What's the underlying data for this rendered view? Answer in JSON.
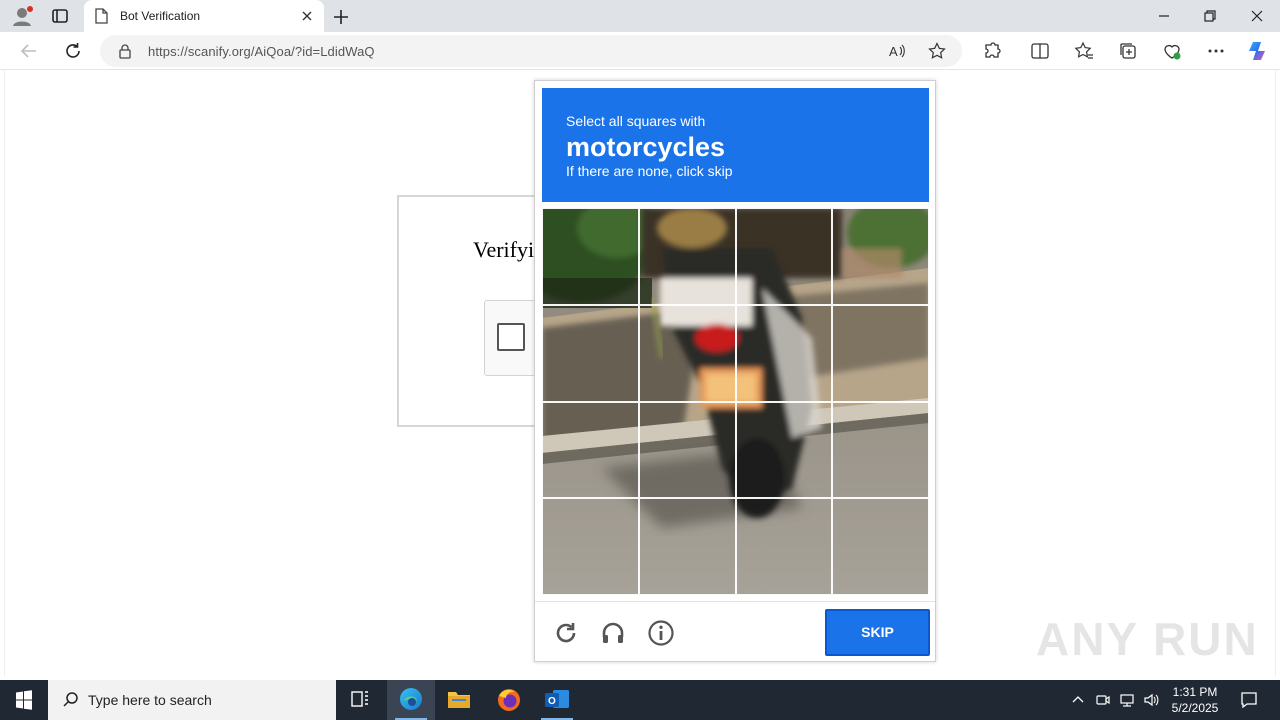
{
  "browser": {
    "tab_title": "Bot Verification",
    "url_domain": "https://scanify.org",
    "url_path": "/AiQoa/?id=LdidWaQ"
  },
  "page": {
    "verify_title": "Verifyi"
  },
  "challenge": {
    "line1": "Select all squares with",
    "target": "motorcycles",
    "line2": "If there are none, click skip",
    "skip_label": "SKIP",
    "grid_rows": 4,
    "grid_cols": 4
  },
  "watermark": "ANY RUN",
  "taskbar": {
    "search_placeholder": "Type here to search",
    "time": "1:31 PM",
    "date": "5/2/2025"
  },
  "colors": {
    "accent": "#1a73e8",
    "taskbar": "#202833"
  }
}
